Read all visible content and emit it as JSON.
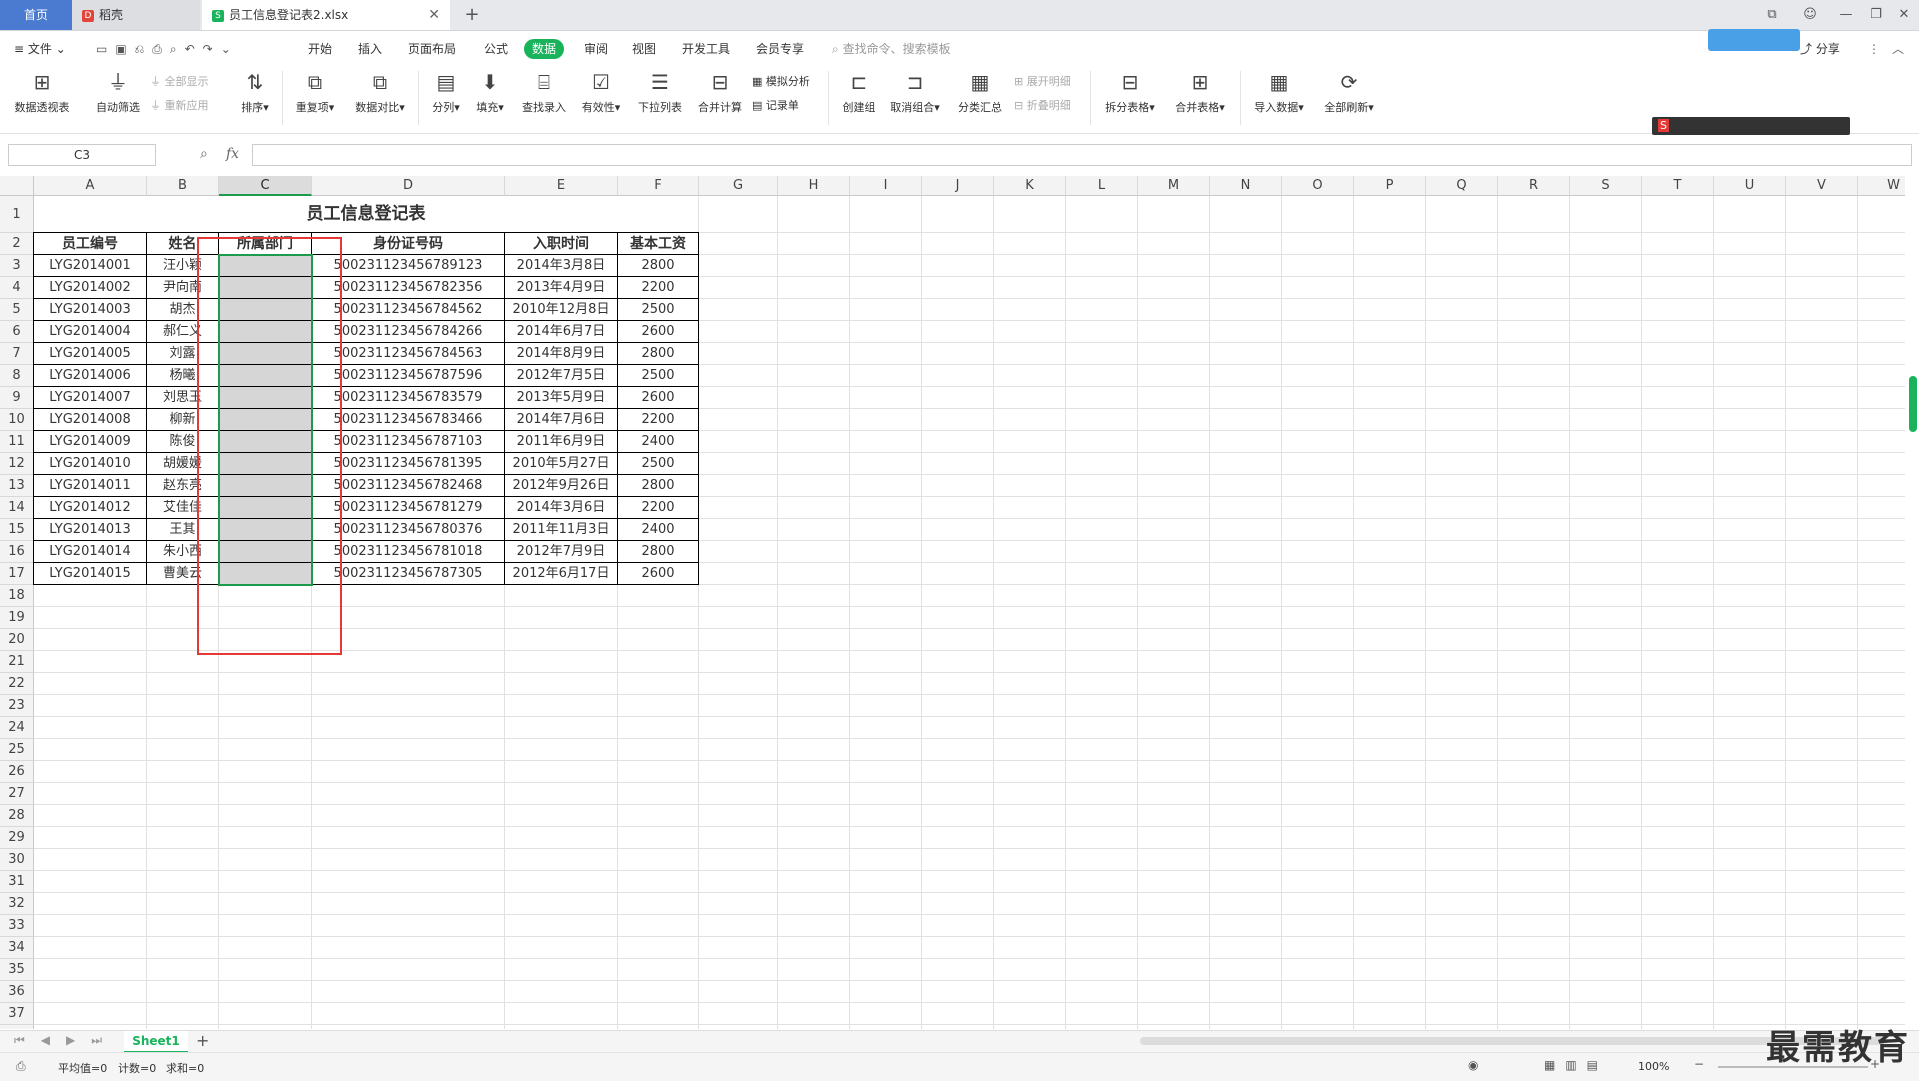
{
  "tabs": {
    "home": "首页",
    "docer": "稻壳",
    "file": "员工信息登记表2.xlsx"
  },
  "menu": {
    "file": "文件",
    "items": [
      "开始",
      "插入",
      "页面布局",
      "公式",
      "数据",
      "审阅",
      "视图",
      "开发工具",
      "会员专享"
    ],
    "search_placeholder": "查找命令、搜索模板",
    "share": "分享"
  },
  "ribbon": {
    "pivot": "数据透视表",
    "autofilter": "自动筛选",
    "show_all": "全部显示",
    "reapply": "重新应用",
    "sort": "排序",
    "dup": "重复项",
    "compare": "数据对比",
    "split": "分列",
    "fill": "填充",
    "lookup": "查找录入",
    "validity": "有效性",
    "dropdown": "下拉列表",
    "consolidate": "合并计算",
    "whatif": "模拟分析",
    "record": "记录单",
    "group": "创建组",
    "ungroup": "取消组合",
    "subtotal": "分类汇总",
    "expand": "展开明细",
    "collapse": "折叠明细",
    "split_table": "拆分表格",
    "merge_table": "合并表格",
    "import": "导入数据",
    "refresh_all": "全部刷新"
  },
  "formula_bar": {
    "name_box": "C3",
    "fx": "fx",
    "value": ""
  },
  "sheet": {
    "columns": [
      "A",
      "B",
      "C",
      "D",
      "E",
      "F",
      "G",
      "H",
      "I",
      "J",
      "K",
      "L",
      "M",
      "N",
      "O",
      "P",
      "Q",
      "R",
      "S",
      "T",
      "U",
      "V",
      "W"
    ],
    "title": "员工信息登记表",
    "headers": [
      "员工编号",
      "姓名",
      "所属部门",
      "身份证号码",
      "入职时间",
      "基本工资"
    ],
    "rows": [
      [
        "LYG2014001",
        "汪小颖",
        "",
        "500231123456789123",
        "2014年3月8日",
        "2800"
      ],
      [
        "LYG2014002",
        "尹向南",
        "",
        "500231123456782356",
        "2013年4月9日",
        "2200"
      ],
      [
        "LYG2014003",
        "胡杰",
        "",
        "500231123456784562",
        "2010年12月8日",
        "2500"
      ],
      [
        "LYG2014004",
        "郝仁义",
        "",
        "500231123456784266",
        "2014年6月7日",
        "2600"
      ],
      [
        "LYG2014005",
        "刘露",
        "",
        "500231123456784563",
        "2014年8月9日",
        "2800"
      ],
      [
        "LYG2014006",
        "杨曦",
        "",
        "500231123456787596",
        "2012年7月5日",
        "2500"
      ],
      [
        "LYG2014007",
        "刘思玉",
        "",
        "500231123456783579",
        "2013年5月9日",
        "2600"
      ],
      [
        "LYG2014008",
        "柳新",
        "",
        "500231123456783466",
        "2014年7月6日",
        "2200"
      ],
      [
        "LYG2014009",
        "陈俊",
        "",
        "500231123456787103",
        "2011年6月9日",
        "2400"
      ],
      [
        "LYG2014010",
        "胡媛媛",
        "",
        "500231123456781395",
        "2010年5月27日",
        "2500"
      ],
      [
        "LYG2014011",
        "赵东亮",
        "",
        "500231123456782468",
        "2012年9月26日",
        "2800"
      ],
      [
        "LYG2014012",
        "艾佳佳",
        "",
        "500231123456781279",
        "2014年3月6日",
        "2200"
      ],
      [
        "LYG2014013",
        "王其",
        "",
        "500231123456780376",
        "2011年11月3日",
        "2400"
      ],
      [
        "LYG2014014",
        "朱小西",
        "",
        "500231123456781018",
        "2012年7月9日",
        "2800"
      ],
      [
        "LYG2014015",
        "曹美云",
        "",
        "500231123456787305",
        "2012年6月17日",
        "2600"
      ]
    ],
    "row_count": 42,
    "sheet_name": "Sheet1"
  },
  "status": {
    "avg": "平均值=0",
    "count": "计数=0",
    "sum": "求和=0",
    "zoom": "100%"
  },
  "watermark": "最需教育",
  "colors": {
    "accent": "#19b35b",
    "home_tab": "#4a7bd0",
    "highlight": "#e53935"
  }
}
